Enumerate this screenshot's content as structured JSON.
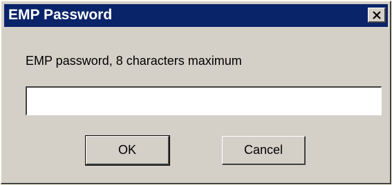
{
  "window": {
    "title": "EMP Password",
    "close_icon": "close-icon"
  },
  "dialog": {
    "prompt": "EMP password, 8 characters maximum",
    "password_value": "",
    "ok_label": "OK",
    "cancel_label": "Cancel"
  },
  "colors": {
    "titlebar": "#0a246a",
    "face": "#d4d0c8",
    "background": "#ffffe8"
  }
}
